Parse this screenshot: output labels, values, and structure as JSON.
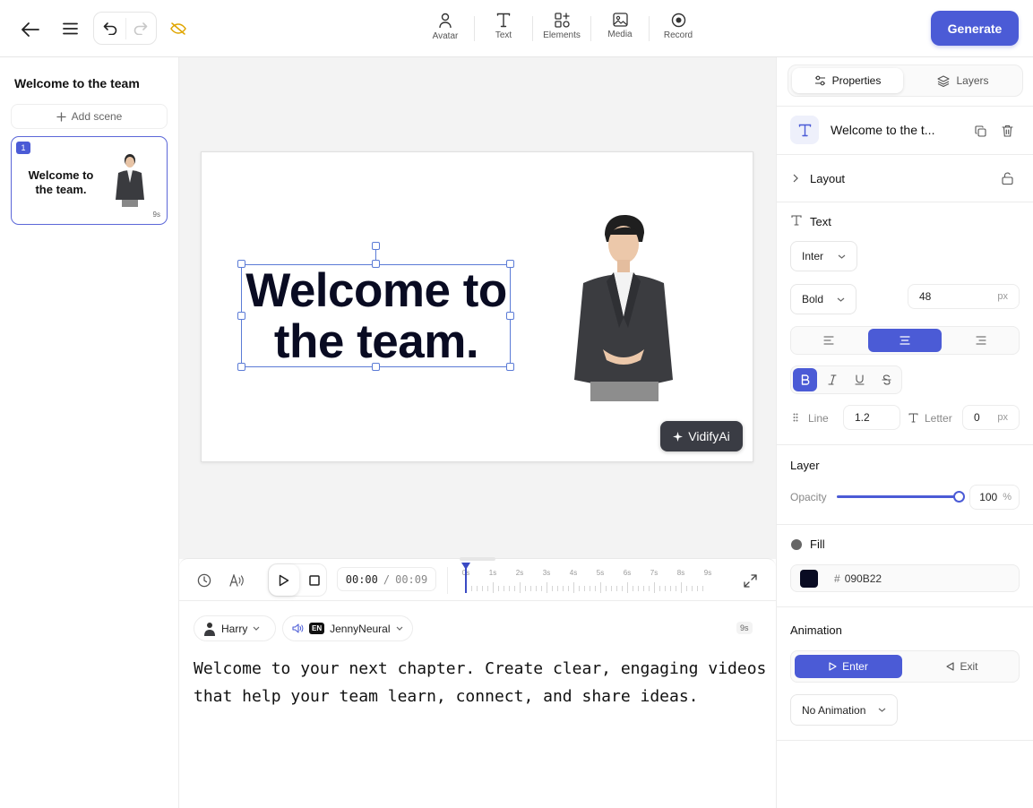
{
  "topbar": {
    "tools": [
      {
        "label": "Avatar",
        "icon": "avatar-icon"
      },
      {
        "label": "Text",
        "icon": "text-icon"
      },
      {
        "label": "Elements",
        "icon": "elements-icon"
      },
      {
        "label": "Media",
        "icon": "media-icon"
      },
      {
        "label": "Record",
        "icon": "record-icon"
      }
    ],
    "generate_label": "Generate"
  },
  "left": {
    "project_title": "Welcome to the team",
    "add_scene_label": "Add scene",
    "scenes": [
      {
        "number": "1",
        "text": "Welcome to the team.",
        "duration": "9s"
      }
    ]
  },
  "canvas": {
    "slide_title": "Welcome to the team.",
    "watermark": "VidifyAi"
  },
  "timeline": {
    "current_time": "00:00",
    "separator": "/",
    "total_time": "00:09",
    "ticks": [
      "0s",
      "1s",
      "2s",
      "3s",
      "4s",
      "5s",
      "6s",
      "7s",
      "8s",
      "9s"
    ]
  },
  "script": {
    "avatar_name": "Harry",
    "voice_lang": "EN",
    "voice_name": "JennyNeural",
    "duration": "9s",
    "text": "Welcome to your next chapter. Create clear, engaging videos that help your team learn, connect, and share ideas."
  },
  "right": {
    "tabs": [
      {
        "label": "Properties",
        "icon": "sliders-icon"
      },
      {
        "label": "Layers",
        "icon": "layers-icon"
      }
    ],
    "active_tab": "Properties",
    "element_name": "Welcome to the t...",
    "layout_label": "Layout",
    "text_section_label": "Text",
    "font_family": "Inter",
    "font_weight": "Bold",
    "font_size": "48",
    "font_size_unit": "px",
    "text_align": "center",
    "bold_active": true,
    "line_label": "Line",
    "line_value": "1.2",
    "letter_label": "Letter",
    "letter_value": "0",
    "letter_unit": "px",
    "layer_label": "Layer",
    "opacity_label": "Opacity",
    "opacity_value": "100",
    "opacity_unit": "%",
    "opacity_level": 1.0,
    "fill_label": "Fill",
    "fill_hash": "#",
    "fill_hex": "090B22",
    "fill_color": "#090B22",
    "animation_label": "Animation",
    "enter_label": "Enter",
    "exit_label": "Exit",
    "animation_value": "No Animation"
  },
  "colors": {
    "accent": "#4b5bd6",
    "text_fill": "#090B22",
    "undo_disabled": "#c8c8c8",
    "hidden_icon": "#e0a500"
  }
}
